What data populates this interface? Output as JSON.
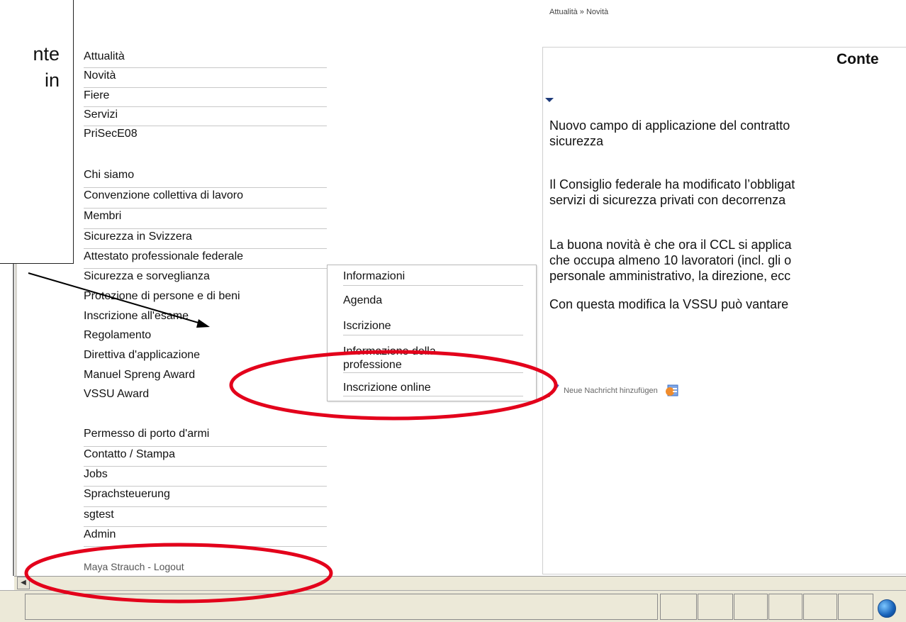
{
  "breadcrumb": "Attualità » Novità",
  "callout": {
    "line1": "nte",
    "line2": "in"
  },
  "nav": {
    "group1": [
      "Attualità",
      "Novità",
      "Fiere",
      "Servizi",
      "PriSecE08"
    ],
    "group2": [
      "Chi siamo",
      "Convenzione collettiva di lavoro",
      "Membri",
      "Sicurezza in Svizzera",
      "Attestato professionale federale",
      "Sicurezza e sorveglianza",
      "Protezione di persone e di beni",
      "Inscrizione all'esame",
      "Regolamento",
      "Direttiva d'applicazione",
      "Manuel Spreng Award",
      "VSSU Award"
    ],
    "group3": [
      "Permesso di porto d'armi",
      "Contatto / Stampa",
      "Jobs",
      "Sprachsteuerung",
      "sgtest",
      "Admin"
    ]
  },
  "user": {
    "name": "Maya Strauch",
    "separator": " - ",
    "logout": "Logout"
  },
  "submenu": [
    "Informazioni",
    "Agenda",
    "Iscrizione",
    "Informazione della",
    "professione",
    "Inscrizione online"
  ],
  "content": {
    "title": "Conte",
    "paragraphs": [
      [
        "Nuovo campo di applicazione del contratto",
        "sicurezza"
      ],
      [
        "Il Consiglio federale ha modificato l’obbligat",
        "servizi di sicurezza privati con decorrenza"
      ],
      [
        "La buona novità è che ora il CCL si applica",
        "che occupa almeno 10 lavoratori (incl. gli o",
        "personale amministrativo, la direzione, ecc"
      ],
      [
        "Con questa modifica la VSSU può vantare"
      ]
    ],
    "add_news": "Neue Nachricht hinzufügen"
  },
  "colors": {
    "annotation_red": "#e3001b",
    "link_blue": "#1d3a7a"
  },
  "icons": [
    "pencil-icon",
    "edit-page-icon",
    "globe-icon",
    "dropdown-arrow-icon",
    "scroll-left-icon"
  ]
}
